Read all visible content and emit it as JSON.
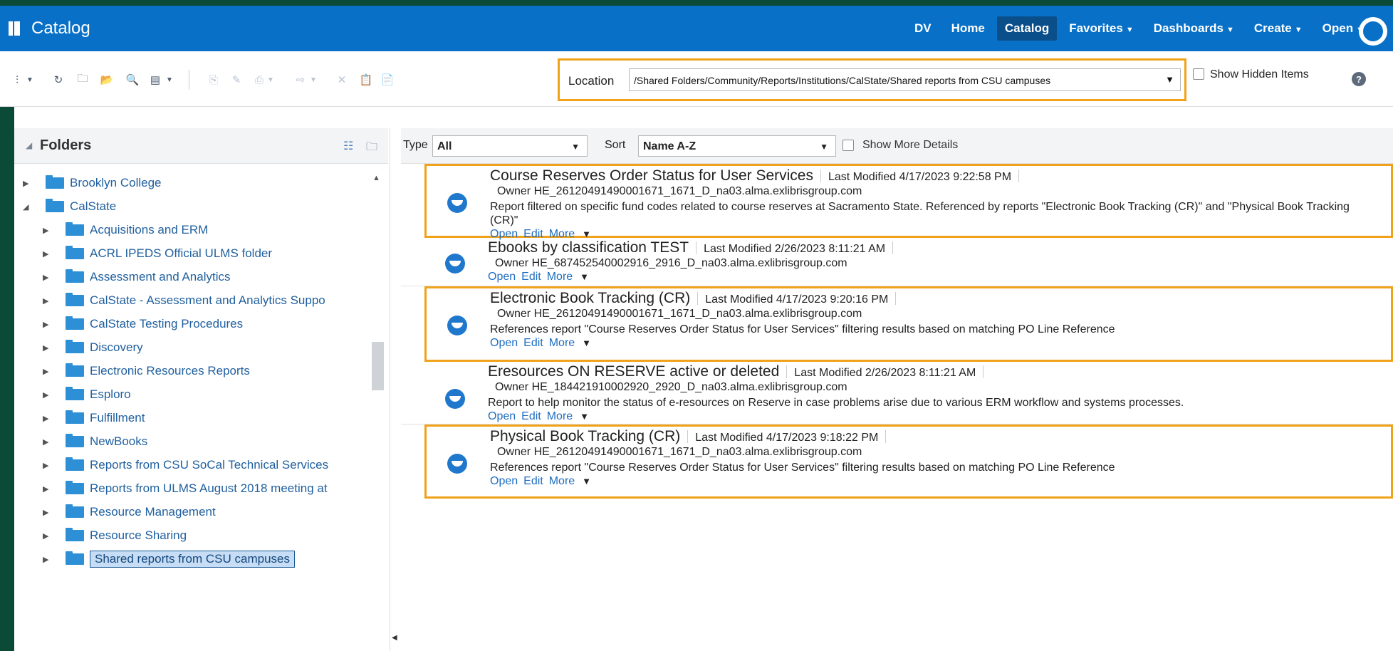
{
  "app": {
    "title": "Catalog",
    "nav": [
      {
        "label": "DV",
        "caret": false,
        "active": false
      },
      {
        "label": "Home",
        "caret": false,
        "active": false
      },
      {
        "label": "Catalog",
        "caret": false,
        "active": true
      },
      {
        "label": "Favorites",
        "caret": true,
        "active": false
      },
      {
        "label": "Dashboards",
        "caret": true,
        "active": false
      },
      {
        "label": "Create",
        "caret": true,
        "active": false
      },
      {
        "label": "Open",
        "caret": true,
        "active": false
      }
    ]
  },
  "toolbar": {
    "location_label": "Location",
    "location_value": "/Shared Folders/Community/Reports/Institutions/CalState/Shared reports from CSU campuses",
    "show_hidden_label": "Show Hidden Items",
    "help_glyph": "?"
  },
  "folders": {
    "title": "Folders",
    "items": [
      {
        "label": "Brooklyn College",
        "level": 0,
        "expanded": false,
        "selected": false
      },
      {
        "label": "CalState",
        "level": 0,
        "expanded": true,
        "selected": false
      },
      {
        "label": "Acquisitions and ERM",
        "level": 1,
        "expanded": false,
        "selected": false
      },
      {
        "label": "ACRL IPEDS Official ULMS folder",
        "level": 1,
        "expanded": false,
        "selected": false
      },
      {
        "label": "Assessment and Analytics",
        "level": 1,
        "expanded": false,
        "selected": false
      },
      {
        "label": "CalState - Assessment and Analytics Suppo",
        "level": 1,
        "expanded": false,
        "selected": false
      },
      {
        "label": "CalState Testing Procedures",
        "level": 1,
        "expanded": false,
        "selected": false
      },
      {
        "label": "Discovery",
        "level": 1,
        "expanded": false,
        "selected": false
      },
      {
        "label": "Electronic Resources Reports",
        "level": 1,
        "expanded": false,
        "selected": false
      },
      {
        "label": "Esploro",
        "level": 1,
        "expanded": false,
        "selected": false
      },
      {
        "label": "Fulfillment",
        "level": 1,
        "expanded": false,
        "selected": false
      },
      {
        "label": "NewBooks",
        "level": 1,
        "expanded": false,
        "selected": false
      },
      {
        "label": "Reports from CSU SoCal Technical Services",
        "level": 1,
        "expanded": false,
        "selected": false
      },
      {
        "label": "Reports from ULMS August 2018 meeting at",
        "level": 1,
        "expanded": false,
        "selected": false
      },
      {
        "label": "Resource Management",
        "level": 1,
        "expanded": false,
        "selected": false
      },
      {
        "label": "Resource Sharing",
        "level": 1,
        "expanded": false,
        "selected": false
      },
      {
        "label": "Shared reports from CSU campuses",
        "level": 1,
        "expanded": false,
        "selected": true
      }
    ]
  },
  "filters": {
    "type_label": "Type",
    "type_value": "All",
    "sort_label": "Sort",
    "sort_value": "Name A-Z",
    "more_details_label": "Show More Details"
  },
  "reports": [
    {
      "name": "Course Reserves Order Status for User Services",
      "last_modified": "Last Modified 4/17/2023 9:22:58 PM",
      "owner": "Owner HE_26120491490001671_1671_D_na03.alma.exlibrisgroup.com",
      "description": "Report filtered on specific fund codes related to course reserves at Sacramento State. Referenced by reports \"Electronic Book Tracking (CR)\" and \"Physical Book Tracking (CR)\"",
      "highlighted": true,
      "actions": [
        "Open",
        "Edit",
        "More"
      ]
    },
    {
      "name": "Ebooks by classification TEST",
      "last_modified": "Last Modified 2/26/2023 8:11:21 AM",
      "owner": "Owner HE_687452540002916_2916_D_na03.alma.exlibrisgroup.com",
      "description": "",
      "highlighted": false,
      "actions": [
        "Open",
        "Edit",
        "More"
      ]
    },
    {
      "name": "Electronic Book Tracking (CR)",
      "last_modified": "Last Modified 4/17/2023 9:20:16 PM",
      "owner": "Owner HE_26120491490001671_1671_D_na03.alma.exlibrisgroup.com",
      "description": "References report \"Course Reserves Order Status for User Services\" filtering results based on matching PO Line Reference",
      "highlighted": true,
      "actions": [
        "Open",
        "Edit",
        "More"
      ]
    },
    {
      "name": "Eresources ON RESERVE active or deleted",
      "last_modified": "Last Modified 2/26/2023 8:11:21 AM",
      "owner": "Owner HE_184421910002920_2920_D_na03.alma.exlibrisgroup.com",
      "description": "Report to help monitor the status of e-resources on Reserve in case problems arise due to various ERM workflow and systems processes.",
      "highlighted": false,
      "actions": [
        "Open",
        "Edit",
        "More"
      ]
    },
    {
      "name": "Physical Book Tracking (CR)",
      "last_modified": "Last Modified 4/17/2023 9:18:22 PM",
      "owner": "Owner HE_26120491490001671_1671_D_na03.alma.exlibrisgroup.com",
      "description": "References report \"Course Reserves Order Status for User Services\" filtering results based on matching PO Line Reference",
      "highlighted": true,
      "actions": [
        "Open",
        "Edit",
        "More"
      ]
    }
  ],
  "colors": {
    "nav_bg": "#0870c6",
    "highlight_border": "#f0a21a",
    "link": "#1f6dc1",
    "folder": "#2d8fd5"
  }
}
